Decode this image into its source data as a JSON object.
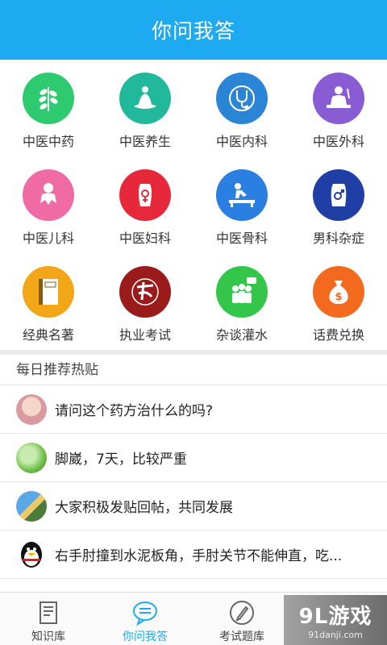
{
  "header": {
    "title": "你问我答"
  },
  "categories": [
    {
      "label": "中医中药",
      "icon": "herb-leaf-icon",
      "color": "#2dca6f"
    },
    {
      "label": "中医养生",
      "icon": "meditation-lotus-icon",
      "color": "#22b89b"
    },
    {
      "label": "中医内科",
      "icon": "stethoscope-icon",
      "color": "#2b85d6"
    },
    {
      "label": "中医外科",
      "icon": "surgeon-icon",
      "color": "#8a5cd3"
    },
    {
      "label": "中医儿科",
      "icon": "baby-icon",
      "color": "#f06aa3"
    },
    {
      "label": "中医妇科",
      "icon": "female-symbol-icon",
      "color": "#e7283b"
    },
    {
      "label": "中医骨科",
      "icon": "massage-bed-icon",
      "color": "#2a7fe0"
    },
    {
      "label": "男科杂症",
      "icon": "male-symbol-icon",
      "color": "#1f3ea6"
    },
    {
      "label": "经典名著",
      "icon": "classic-book-icon",
      "color": "#f2a718"
    },
    {
      "label": "执业考试",
      "icon": "exam-calligraphy-icon",
      "color": "#9a1b1b"
    },
    {
      "label": "杂谈灌水",
      "icon": "group-chat-icon",
      "color": "#33c64a"
    },
    {
      "label": "话费兑换",
      "icon": "money-bag-icon",
      "color": "#f36a1f"
    }
  ],
  "daily": {
    "title": "每日推荐热贴",
    "posts": [
      {
        "text": "请问这个药方治什么的吗?",
        "avatar": "girl-avatar"
      },
      {
        "text": "脚崴，7天，比较严重",
        "avatar": "green-plant-avatar"
      },
      {
        "text": "大家积极发贴回帖，共同发展",
        "avatar": "bird-avatar"
      },
      {
        "text": "右手肘撞到水泥板角，手肘关节不能伸直，吃...",
        "avatar": "penguin-avatar"
      }
    ]
  },
  "tabs": [
    {
      "label": "知识库",
      "icon": "document-icon",
      "active": false
    },
    {
      "label": "你问我答",
      "icon": "chat-bubble-icon",
      "active": true
    },
    {
      "label": "考试题库",
      "icon": "pencil-icon",
      "active": false
    }
  ],
  "watermark": {
    "main": "9L游戏",
    "sub": "91danji.com"
  },
  "colors": {
    "primary": "#1eaaf1"
  }
}
